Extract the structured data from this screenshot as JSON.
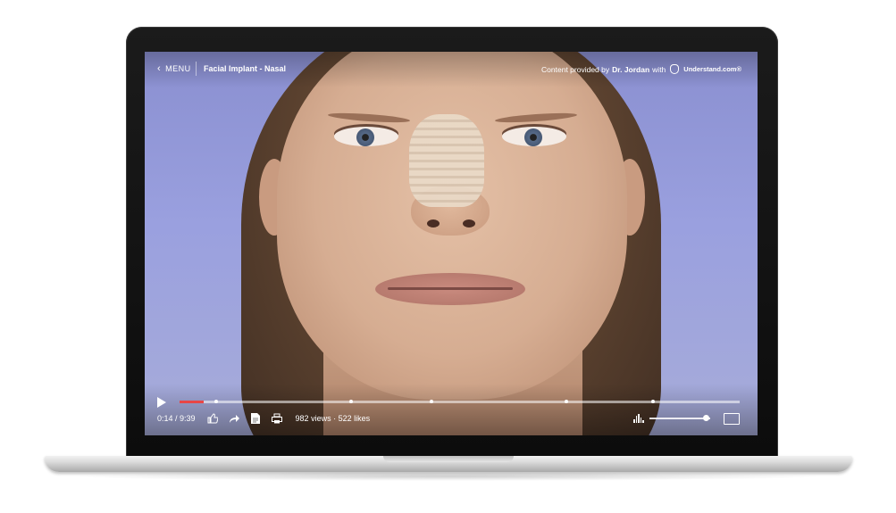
{
  "player": {
    "menu_label": "MENU",
    "title": "Facial Implant - Nasal",
    "provider_prefix": "Content provided by",
    "provider_name": "Dr. Jordan",
    "provider_with": "with",
    "brand": "Understand.com®",
    "time": "0:14 / 9:39",
    "views": "982 views",
    "separator": "·",
    "likes": "522 likes",
    "progress_fraction": 0.043,
    "chapter_fractions": [
      0.066,
      0.306,
      0.45,
      0.69,
      0.846
    ],
    "volume_fraction": 0.93,
    "colors": {
      "progress": "#e84646",
      "accent": "#ffffff"
    }
  },
  "icons": [
    "back-chevron-icon",
    "play-icon",
    "like-icon",
    "share-icon",
    "transcript-icon",
    "print-icon",
    "volume-icon",
    "fullscreen-icon",
    "understand-logo-icon"
  ]
}
